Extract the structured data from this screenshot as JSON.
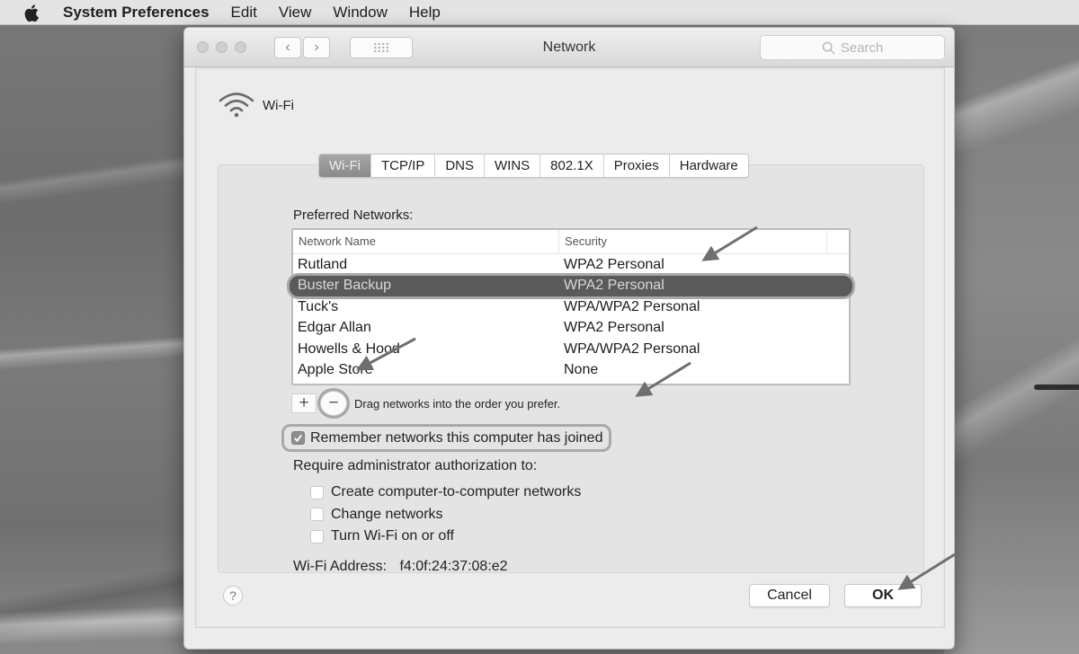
{
  "menubar": {
    "apple_icon": "apple-logo",
    "app_name": "System Preferences",
    "items": [
      "Edit",
      "View",
      "Window",
      "Help"
    ]
  },
  "window": {
    "title": "Network",
    "search_placeholder": "Search",
    "nav_back_icon": "chevron-left",
    "nav_forward_icon": "chevron-right",
    "show_all_icon": "grid"
  },
  "interface": {
    "icon": "wifi-icon",
    "name": "Wi-Fi"
  },
  "tabs": [
    {
      "label": "Wi-Fi",
      "active": true
    },
    {
      "label": "TCP/IP",
      "active": false
    },
    {
      "label": "DNS",
      "active": false
    },
    {
      "label": "WINS",
      "active": false
    },
    {
      "label": "802.1X",
      "active": false
    },
    {
      "label": "Proxies",
      "active": false
    },
    {
      "label": "Hardware",
      "active": false
    }
  ],
  "preferred": {
    "label": "Preferred Networks:",
    "columns": [
      "Network Name",
      "Security"
    ],
    "rows": [
      {
        "name": "Rutland",
        "security": "WPA2 Personal",
        "selected": false
      },
      {
        "name": "Buster Backup",
        "security": "WPA2 Personal",
        "selected": true
      },
      {
        "name": "Tuck's",
        "security": "WPA/WPA2 Personal",
        "selected": false
      },
      {
        "name": "Edgar Allan",
        "security": "WPA2 Personal",
        "selected": false
      },
      {
        "name": "Howells & Hood",
        "security": "WPA/WPA2 Personal",
        "selected": false
      },
      {
        "name": "Apple Store",
        "security": "None",
        "selected": false
      }
    ],
    "add_label": "+",
    "remove_label": "−",
    "drag_hint": "Drag networks into the order you prefer."
  },
  "remember": {
    "label": "Remember networks this computer has joined",
    "checked": true
  },
  "require": {
    "label": "Require administrator authorization to:",
    "options": [
      {
        "label": "Create computer-to-computer networks",
        "checked": false
      },
      {
        "label": "Change networks",
        "checked": false
      },
      {
        "label": "Turn Wi-Fi on or off",
        "checked": false
      }
    ]
  },
  "address": {
    "label": "Wi-Fi Address:",
    "value": "f4:0f:24:37:08:e2"
  },
  "footer": {
    "help_label": "?",
    "cancel_label": "Cancel",
    "ok_label": "OK"
  },
  "colors": {
    "selection": "#5a5a5a",
    "highlight_ring": "#a7a7a7",
    "arrow": "#6f6f6f"
  }
}
